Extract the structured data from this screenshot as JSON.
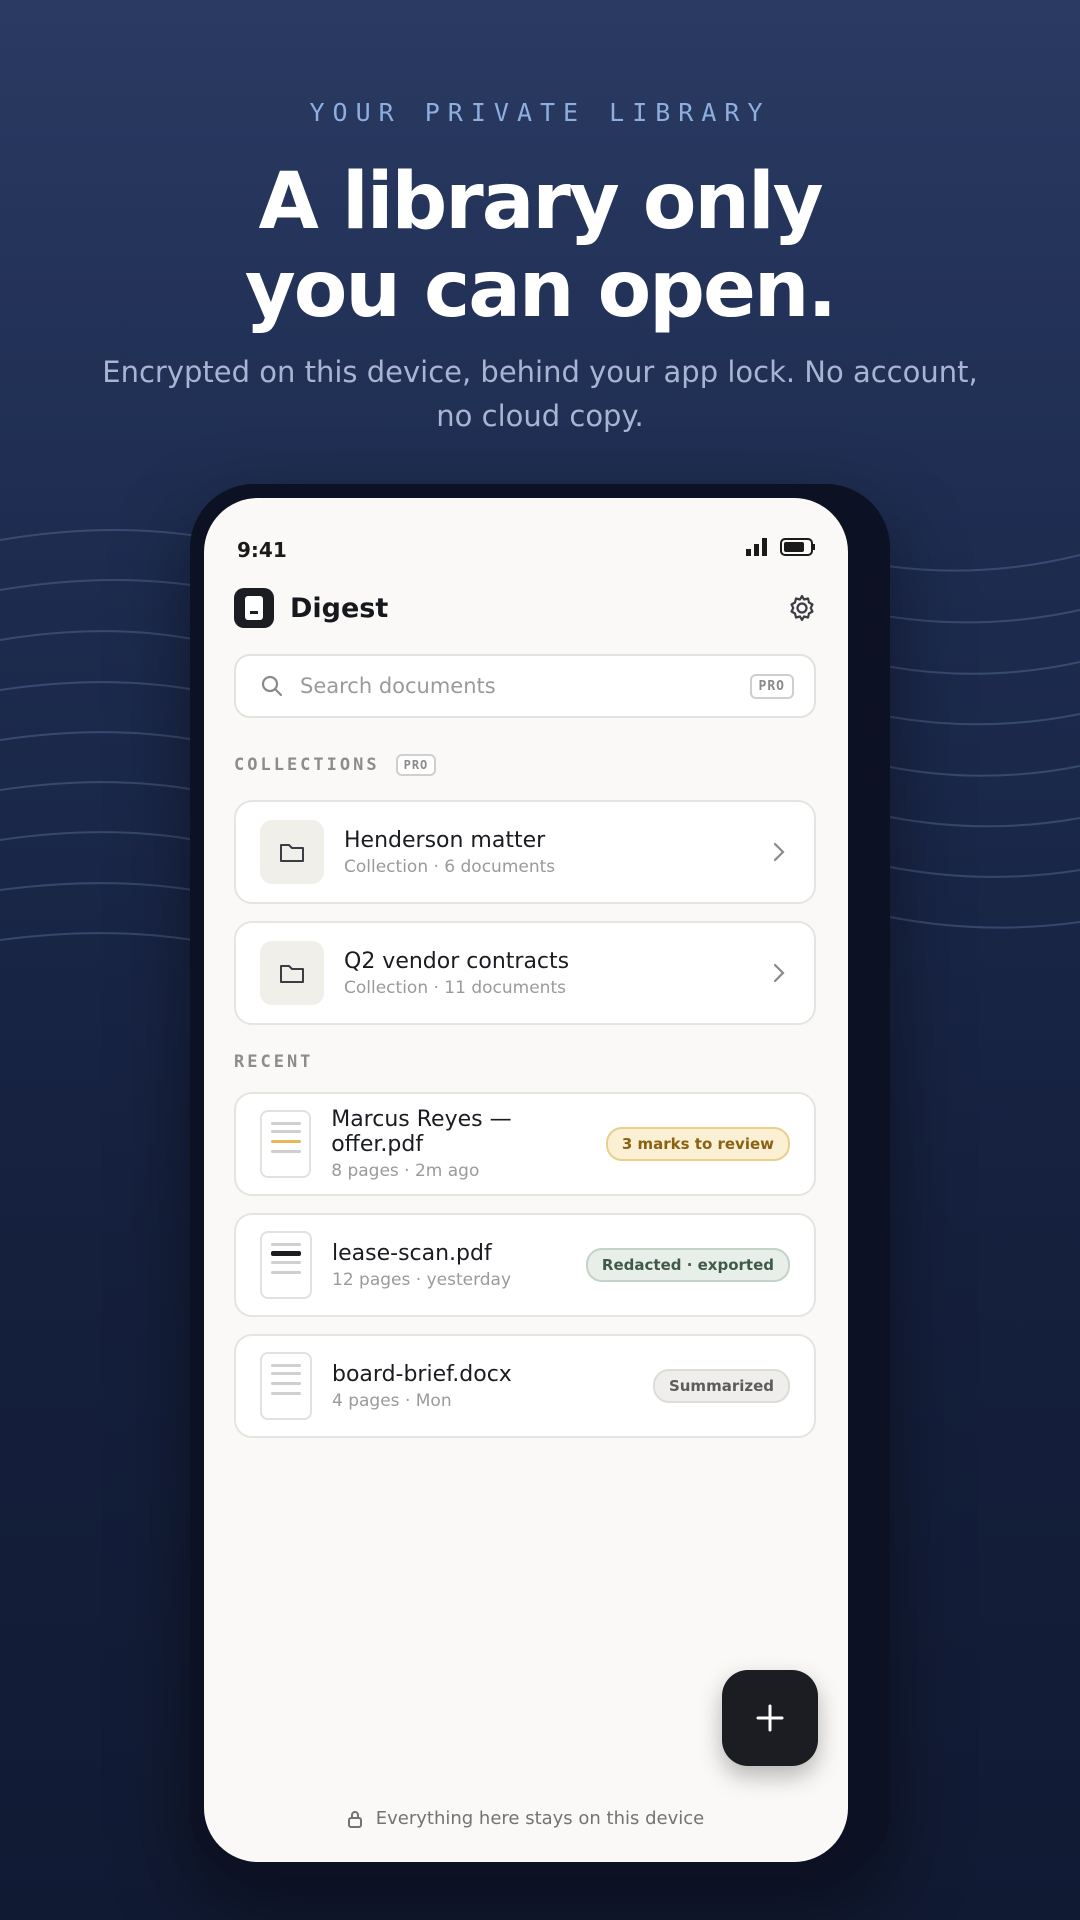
{
  "hero": {
    "eyebrow": "YOUR PRIVATE LIBRARY",
    "headline_line1": "A library only",
    "headline_line2": "you can open.",
    "subhead": "Encrypted on this device, behind your app lock. No account, no cloud copy."
  },
  "status_bar": {
    "time": "9:41"
  },
  "app": {
    "title": "Digest",
    "search_placeholder": "Search documents",
    "pro_label": "PRO"
  },
  "collections": {
    "label": "COLLECTIONS",
    "items": [
      {
        "title": "Henderson matter",
        "subtitle": "Collection · 6 documents"
      },
      {
        "title": "Q2 vendor contracts",
        "subtitle": "Collection · 11 documents"
      }
    ]
  },
  "recent": {
    "label": "RECENT",
    "items": [
      {
        "title": "Marcus Reyes — offer.pdf",
        "subtitle": "8 pages · 2m ago",
        "tag": "3 marks to review"
      },
      {
        "title": "lease-scan.pdf",
        "subtitle": "12 pages · yesterday",
        "tag": "Redacted · exported"
      },
      {
        "title": "board-brief.docx",
        "subtitle": "4 pages · Mon",
        "tag": "Summarized"
      }
    ]
  },
  "footer": {
    "text": "Everything here stays on this device"
  },
  "colors": {
    "tag_review_bg": "#fbf0d3",
    "tag_review_border": "#e8cf8c",
    "tag_review_text": "#8a6214",
    "tag_redacted_bg": "#e8efea",
    "tag_redacted_border": "#c3d3c8",
    "tag_redacted_text": "#3f5a48",
    "tag_summary_bg": "#efeeec",
    "tag_summary_border": "#dedcd8",
    "tag_summary_text": "#5c5c5c"
  },
  "icons": {
    "logo": "document-lock-icon",
    "settings": "gear-icon",
    "search": "search-icon",
    "folder": "folder-icon",
    "chevron": "chevron-right-icon",
    "add": "plus-icon",
    "lock": "lock-icon"
  }
}
